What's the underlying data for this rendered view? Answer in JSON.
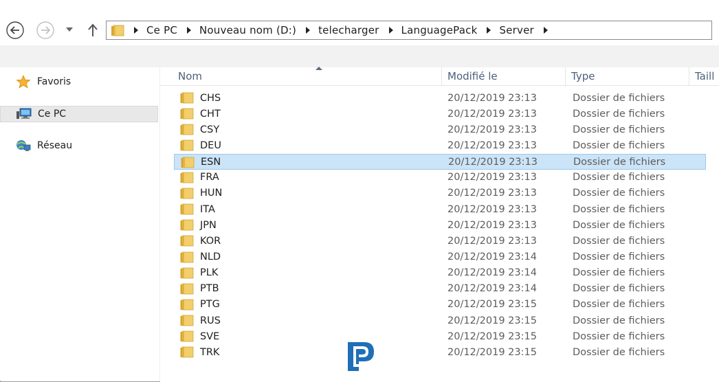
{
  "navigation": {
    "back_icon": "back-arrow-icon",
    "forward_icon": "forward-arrow-icon",
    "recent_icon": "chevron-down-icon",
    "up_icon": "up-arrow-icon"
  },
  "address_bar": {
    "breadcrumbs": [
      "Ce PC",
      "Nouveau nom (D:)",
      "telecharger",
      "LanguagePack",
      "Server"
    ]
  },
  "sidebar": {
    "items": [
      {
        "label": "Favoris",
        "icon": "star-icon"
      },
      {
        "label": "Ce PC",
        "icon": "computer-icon",
        "selected": true
      },
      {
        "label": "Réseau",
        "icon": "network-icon"
      }
    ]
  },
  "columns": [
    "Nom",
    "Modifié le",
    "Type",
    "Taill"
  ],
  "sort": {
    "column": "Nom",
    "direction": "ascending"
  },
  "files": [
    {
      "name": "CHS",
      "modified": "20/12/2019 23:13",
      "type": "Dossier de fichiers"
    },
    {
      "name": "CHT",
      "modified": "20/12/2019 23:13",
      "type": "Dossier de fichiers"
    },
    {
      "name": "CSY",
      "modified": "20/12/2019 23:13",
      "type": "Dossier de fichiers"
    },
    {
      "name": "DEU",
      "modified": "20/12/2019 23:13",
      "type": "Dossier de fichiers"
    },
    {
      "name": "ESN",
      "modified": "20/12/2019 23:13",
      "type": "Dossier de fichiers",
      "selected": true
    },
    {
      "name": "FRA",
      "modified": "20/12/2019 23:13",
      "type": "Dossier de fichiers"
    },
    {
      "name": "HUN",
      "modified": "20/12/2019 23:13",
      "type": "Dossier de fichiers"
    },
    {
      "name": "ITA",
      "modified": "20/12/2019 23:13",
      "type": "Dossier de fichiers"
    },
    {
      "name": "JPN",
      "modified": "20/12/2019 23:13",
      "type": "Dossier de fichiers"
    },
    {
      "name": "KOR",
      "modified": "20/12/2019 23:13",
      "type": "Dossier de fichiers"
    },
    {
      "name": "NLD",
      "modified": "20/12/2019 23:14",
      "type": "Dossier de fichiers"
    },
    {
      "name": "PLK",
      "modified": "20/12/2019 23:14",
      "type": "Dossier de fichiers"
    },
    {
      "name": "PTB",
      "modified": "20/12/2019 23:14",
      "type": "Dossier de fichiers"
    },
    {
      "name": "PTG",
      "modified": "20/12/2019 23:15",
      "type": "Dossier de fichiers"
    },
    {
      "name": "RUS",
      "modified": "20/12/2019 23:15",
      "type": "Dossier de fichiers"
    },
    {
      "name": "SVE",
      "modified": "20/12/2019 23:15",
      "type": "Dossier de fichiers"
    },
    {
      "name": "TRK",
      "modified": "20/12/2019 23:15",
      "type": "Dossier de fichiers"
    }
  ],
  "colors": {
    "selection_bg": "#cce4f7",
    "selection_border": "#99c9ef",
    "header_text": "#4c607a",
    "folder_yellow": "#e8c357",
    "watermark_blue": "#1f6fb8"
  },
  "watermark": {
    "icon": "site-logo-icon"
  }
}
